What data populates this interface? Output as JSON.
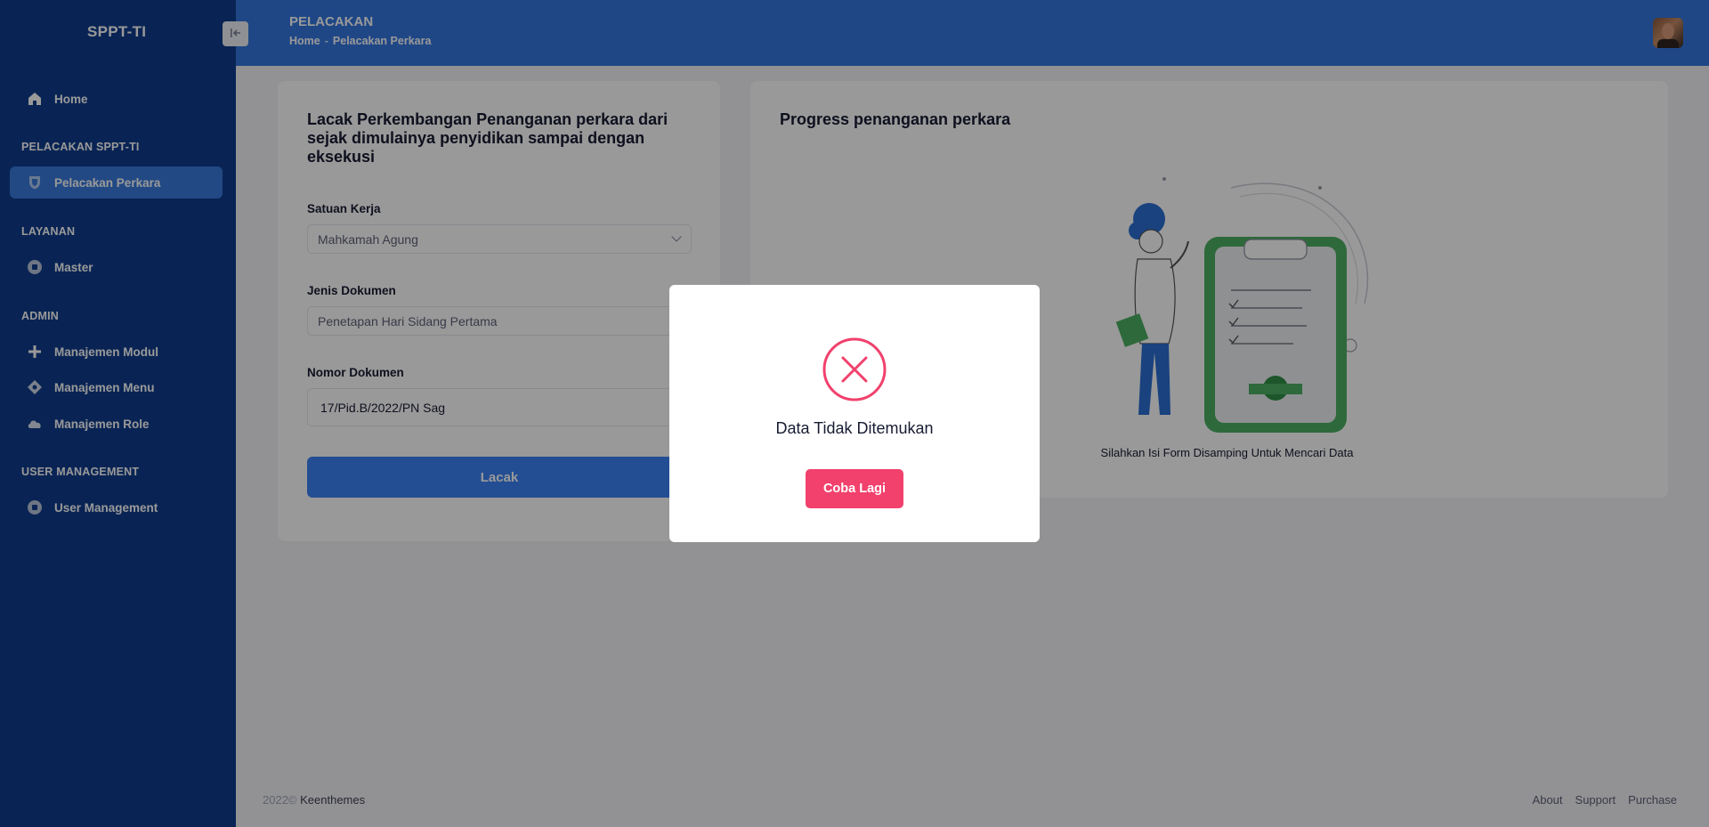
{
  "app": {
    "brand": "SPPT-TI"
  },
  "header": {
    "title": "PELACAKAN",
    "breadcrumb": {
      "home": "Home",
      "separator": "-",
      "current": "Pelacakan Perkara"
    }
  },
  "sidebar": {
    "home": "Home",
    "sections": [
      {
        "title": "PELACAKAN SPPT-TI",
        "items": [
          {
            "label": "Pelacakan Perkara",
            "icon": "shield-icon",
            "active": true
          }
        ]
      },
      {
        "title": "LAYANAN",
        "items": [
          {
            "label": "Master",
            "icon": "record-icon"
          }
        ]
      },
      {
        "title": "ADMIN",
        "items": [
          {
            "label": "Manajemen Modul",
            "icon": "plus-icon"
          },
          {
            "label": "Manajemen Menu",
            "icon": "diamond-icon"
          },
          {
            "label": "Manajemen Role",
            "icon": "cloud-icon"
          }
        ]
      },
      {
        "title": "USER MANAGEMENT",
        "items": [
          {
            "label": "User Management",
            "icon": "record-icon"
          }
        ]
      }
    ]
  },
  "form": {
    "title": "Lacak Perkembangan Penanganan perkara dari sejak dimulainya penyidikan sampai dengan eksekusi",
    "satuan_kerja": {
      "label": "Satuan Kerja",
      "value": "Mahkamah Agung"
    },
    "jenis_dokumen": {
      "label": "Jenis Dokumen",
      "value": "Penetapan Hari Sidang Pertama"
    },
    "nomor_dokumen": {
      "label": "Nomor Dokumen",
      "value": "17/Pid.B/2022/PN Sag"
    },
    "submit": "Lacak"
  },
  "progress": {
    "title": "Progress penanganan perkara",
    "empty_text": "Silahkan Isi Form Disamping Untuk Mencari Data"
  },
  "modal": {
    "message": "Data Tidak Ditemukan",
    "button": "Coba Lagi"
  },
  "footer": {
    "year": "2022©",
    "company": "Keenthemes",
    "links": [
      "About",
      "Support",
      "Purchase"
    ]
  },
  "colors": {
    "sidebar": "#0f3c8c",
    "header": "#3577e0",
    "primary": "#3b82f6",
    "danger": "#f1416c"
  }
}
